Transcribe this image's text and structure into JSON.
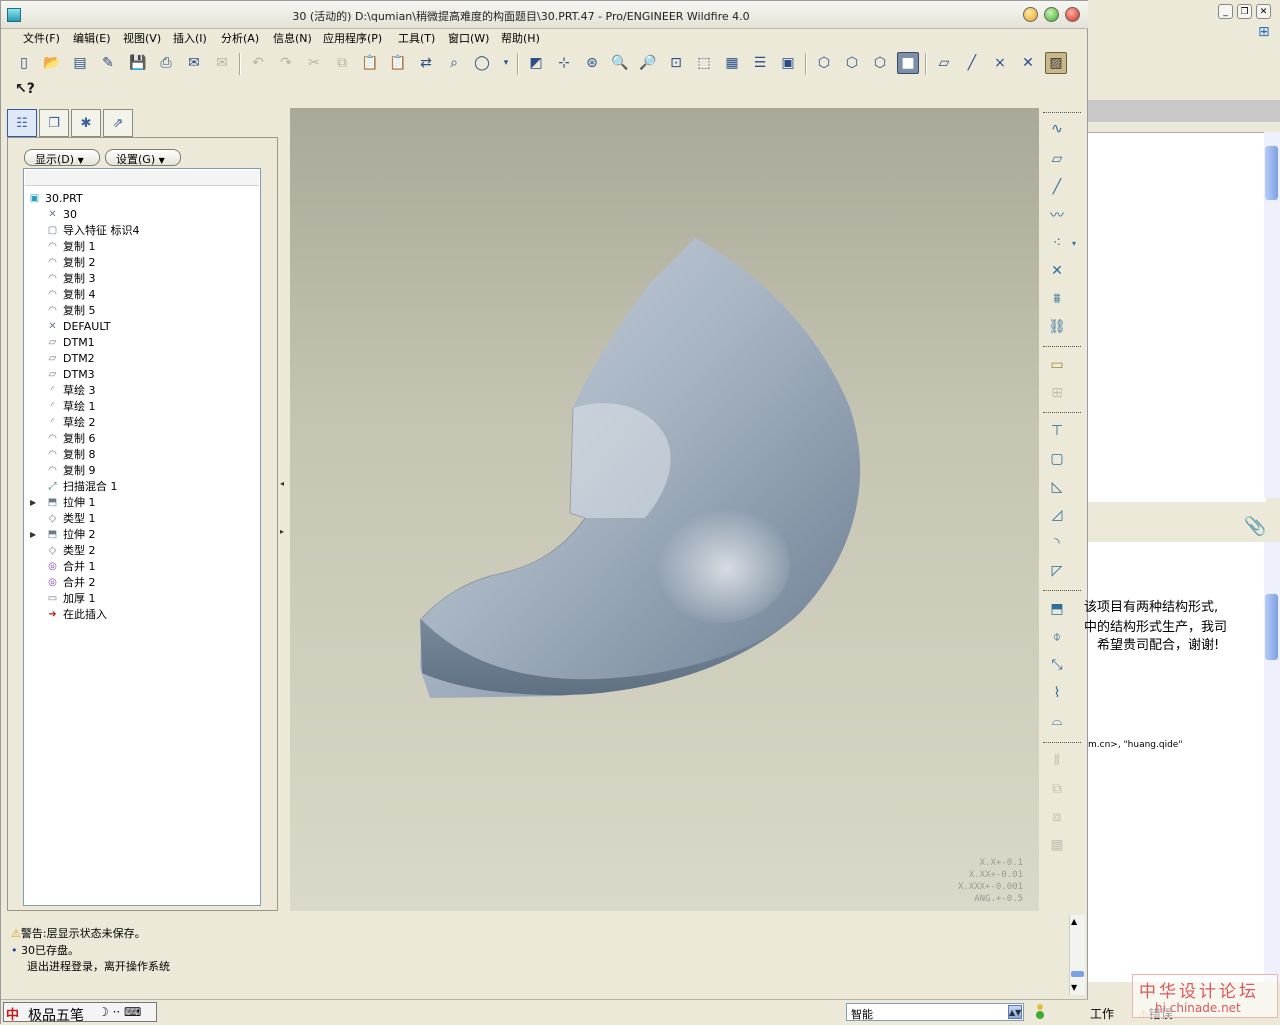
{
  "window": {
    "title": "30 (活动的) D:\\qumian\\稍微提高难度的构面题目\\30.PRT.47 - Pro/ENGINEER Wildfire 4.0"
  },
  "menu": [
    "文件(F)",
    "编辑(E)",
    "视图(V)",
    "插入(I)",
    "分析(A)",
    "信息(N)",
    "应用程序(P)",
    "工具(T)",
    "窗口(W)",
    "帮助(H)"
  ],
  "navigator": {
    "show_button": "显示(D)",
    "settings_button": "设置(G)"
  },
  "model_tree": [
    {
      "label": "30.PRT",
      "icon": "part-icon"
    },
    {
      "label": "30",
      "icon": "csys-icon"
    },
    {
      "label": "导入特征 标识4",
      "icon": "import-feature-icon"
    },
    {
      "label": "复制 1",
      "icon": "copy-surface-icon"
    },
    {
      "label": "复制 2",
      "icon": "copy-surface-icon"
    },
    {
      "label": "复制 3",
      "icon": "copy-surface-icon"
    },
    {
      "label": "复制 4",
      "icon": "copy-surface-icon"
    },
    {
      "label": "复制 5",
      "icon": "copy-surface-icon"
    },
    {
      "label": "DEFAULT",
      "icon": "csys-icon"
    },
    {
      "label": "DTM1",
      "icon": "datum-plane-icon"
    },
    {
      "label": "DTM2",
      "icon": "datum-plane-icon"
    },
    {
      "label": "DTM3",
      "icon": "datum-plane-icon"
    },
    {
      "label": "草绘 3",
      "icon": "sketch-icon"
    },
    {
      "label": "草绘 1",
      "icon": "sketch-icon"
    },
    {
      "label": "草绘 2",
      "icon": "sketch-icon"
    },
    {
      "label": "复制 6",
      "icon": "copy-surface-icon"
    },
    {
      "label": "复制 8",
      "icon": "copy-surface-icon"
    },
    {
      "label": "复制 9",
      "icon": "copy-surface-icon"
    },
    {
      "label": "扫描混合 1",
      "icon": "swept-blend-icon"
    },
    {
      "label": "拉伸 1",
      "icon": "extrude-icon",
      "expandable": true
    },
    {
      "label": "类型 1",
      "icon": "boundary-blend-icon"
    },
    {
      "label": "拉伸 2",
      "icon": "extrude-icon",
      "expandable": true
    },
    {
      "label": "类型 2",
      "icon": "boundary-blend-icon"
    },
    {
      "label": "合并 1",
      "icon": "merge-icon"
    },
    {
      "label": "合并 2",
      "icon": "merge-icon"
    },
    {
      "label": "加厚 1",
      "icon": "thicken-icon"
    },
    {
      "label": "在此插入",
      "icon": "insert-here-arrow-icon"
    }
  ],
  "graphics": {
    "tolerance": [
      "X.X+-0.1",
      "X.XX+-0.01",
      "X.XXX+-0.001",
      "ANG.+-0.5"
    ]
  },
  "messages": [
    {
      "icon": "warning-icon",
      "text": "警告:层显示状态未保存。"
    },
    {
      "icon": "bullet-icon",
      "text": "30已存盘。"
    },
    {
      "icon": "",
      "text": "退出进程登录，离开操作系统"
    }
  ],
  "status": {
    "ime_name": "极品五笔",
    "filter_value": "智能"
  },
  "background_window": {
    "line1": "该项目有两种结构形式,",
    "line2": "中的结构形式生产，我司",
    "line3": "希望贵司配合，谢谢!",
    "email_fragment": "m.cn>, \"huang.qide\"",
    "status_work": "工作",
    "status_error": "错误",
    "watermark_cn": "中华设计论坛",
    "watermark_url": "hi.chinade.net"
  },
  "colors": {
    "accent": "#2f5ba6",
    "model_surface": "#a9b5c2",
    "graphics_bg_top": "#aaa999",
    "graphics_bg_bottom": "#dad9c9"
  }
}
